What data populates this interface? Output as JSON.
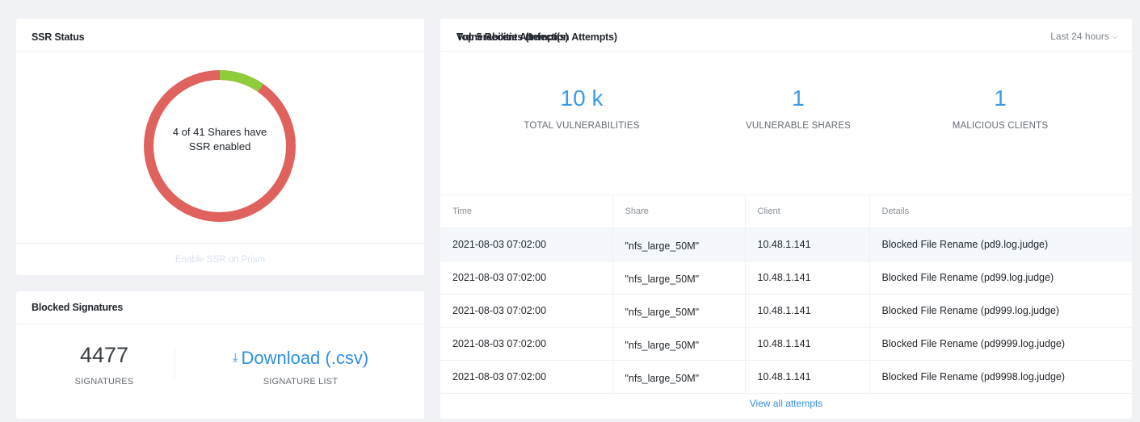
{
  "ssr": {
    "title": "SSR Status",
    "enabled_count": 4,
    "total_count": 41,
    "center_label": "4 of 41 Shares have SSR enabled",
    "enable_link": "Enable SSR on Prism",
    "colors": {
      "enabled": "#8fcc3c",
      "disabled": "#e0625f"
    }
  },
  "signatures": {
    "title": "Blocked Signatures",
    "count": "4477",
    "count_caption": "SIGNATURES",
    "download_icon": "download-icon",
    "download_label": "Download (.csv)",
    "download_caption": "SIGNATURE LIST"
  },
  "vulnerabilities": {
    "title": "Vulnerabilities (Infection Attempts)",
    "range": "Last 24 hours",
    "stats": [
      {
        "value": "10 k",
        "label": "TOTAL VULNERABILITIES"
      },
      {
        "value": "1",
        "label": "VULNERABLE SHARES"
      },
      {
        "value": "1",
        "label": "MALICIOUS CLIENTS"
      }
    ],
    "recent_title": "Top 5 Recent Attempt(s)",
    "columns": [
      "Time",
      "Share",
      "Client",
      "Details"
    ],
    "rows": [
      [
        "2021-08-03 07:02:00",
        "\"nfs_large_50M\"",
        "10.48.1.141",
        "Blocked File Rename (pd9.log.judge)"
      ],
      [
        "2021-08-03 07:02:00",
        "\"nfs_large_50M\"",
        "10.48.1.141",
        "Blocked File Rename (pd99.log.judge)"
      ],
      [
        "2021-08-03 07:02:00",
        "\"nfs_large_50M\"",
        "10.48.1.141",
        "Blocked File Rename (pd999.log.judge)"
      ],
      [
        "2021-08-03 07:02:00",
        "\"nfs_large_50M\"",
        "10.48.1.141",
        "Blocked File Rename (pd9999.log.judge)"
      ],
      [
        "2021-08-03 07:02:00",
        "\"nfs_large_50M\"",
        "10.48.1.141",
        "Blocked File Rename (pd9998.log.judge)"
      ]
    ],
    "view_all": "View all attempts"
  }
}
